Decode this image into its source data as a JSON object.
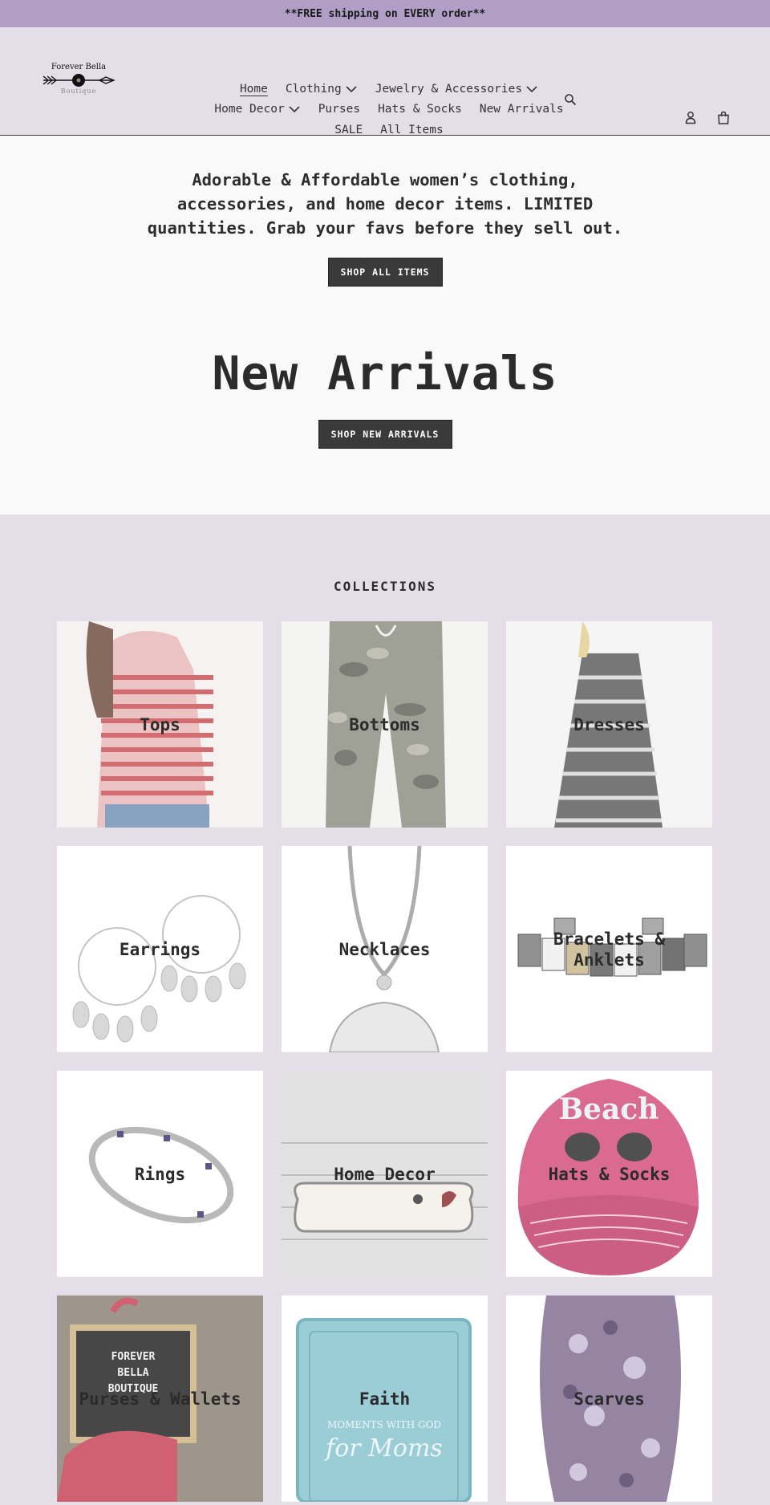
{
  "announcement": "**FREE shipping on EVERY order**",
  "logo": {
    "name": "Forever Bella",
    "sub": "Boutique"
  },
  "nav": {
    "home": "Home",
    "clothing": "Clothing",
    "jewelry": "Jewelry & Accessories",
    "home_decor": "Home Decor",
    "purses": "Purses",
    "hats": "Hats & Socks",
    "new_arrivals": "New Arrivals",
    "sale": "SALE",
    "all_items": "All Items"
  },
  "icons": {
    "search": "search-icon",
    "account": "account-icon",
    "cart": "cart-icon",
    "chevron": "chevron-down-icon"
  },
  "hero": {
    "text": "Adorable & Affordable women’s clothing, accessories, and home decor items.  LIMITED quantities. Grab your favs before they sell out.",
    "shop_button": "SHOP ALL ITEMS",
    "new_title": "New Arrivals",
    "new_button": "SHOP NEW ARRIVALS"
  },
  "collections": {
    "title": "COLLECTIONS",
    "items": [
      {
        "label": "Tops"
      },
      {
        "label": "Bottoms"
      },
      {
        "label": "Dresses"
      },
      {
        "label": "Earrings"
      },
      {
        "label": "Necklaces"
      },
      {
        "label": "Bracelets & Anklets"
      },
      {
        "label": "Rings"
      },
      {
        "label": "Home Decor"
      },
      {
        "label": "Hats & Socks"
      },
      {
        "label": "Purses & Wallets"
      },
      {
        "label": "Faith"
      },
      {
        "label": "Scarves"
      }
    ]
  },
  "colors": {
    "accent": "#b09ec7",
    "background": "#e4dee9",
    "button": "#3a3a3a"
  }
}
